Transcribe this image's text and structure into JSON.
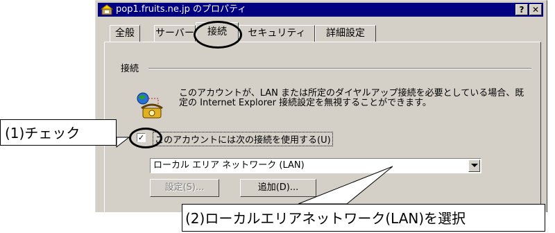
{
  "window": {
    "title": "pop1.fruits.ne.jp のプロパティ",
    "help_button": "?",
    "close_button": "✕"
  },
  "tabs": [
    {
      "label": "全般"
    },
    {
      "label": "サーバー"
    },
    {
      "label": "接続",
      "active": true
    },
    {
      "label": "セキュリティ"
    },
    {
      "label": "詳細設定"
    }
  ],
  "connection": {
    "group_label": "接続",
    "description": "このアカウントが、LAN または所定のダイヤルアップ接続を必要としている場合、既定の Internet Explorer 接続設定を無視することができます。",
    "checkbox_label": "このアカウントには次の接続を使用する(U)",
    "checkbox_checked": true,
    "dropdown_value": "ローカル エリア ネットワーク (LAN)",
    "settings_button": "設定(S)...",
    "add_button": "追加(D)..."
  },
  "annotations": {
    "step1": "(1)チェック",
    "step2": "(2)ローカルエリアネットワーク(LAN)を選択"
  },
  "colors": {
    "dialog_face": "#d4d0c8",
    "titlebar": "#000080"
  }
}
